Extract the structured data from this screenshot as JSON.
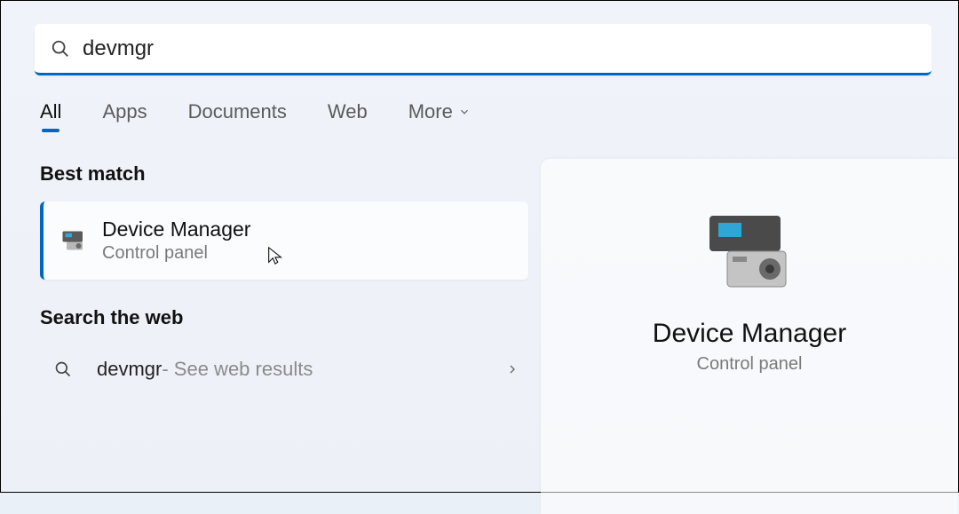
{
  "search": {
    "query": "devmgr"
  },
  "tabs": {
    "all": "All",
    "apps": "Apps",
    "documents": "Documents",
    "web": "Web",
    "more": "More"
  },
  "sections": {
    "best_match": "Best match",
    "search_web": "Search the web"
  },
  "best_match_result": {
    "title": "Device Manager",
    "subtitle": "Control panel"
  },
  "web_result": {
    "query": "devmgr",
    "hint": " - See web results"
  },
  "preview": {
    "title": "Device Manager",
    "subtitle": "Control panel"
  }
}
